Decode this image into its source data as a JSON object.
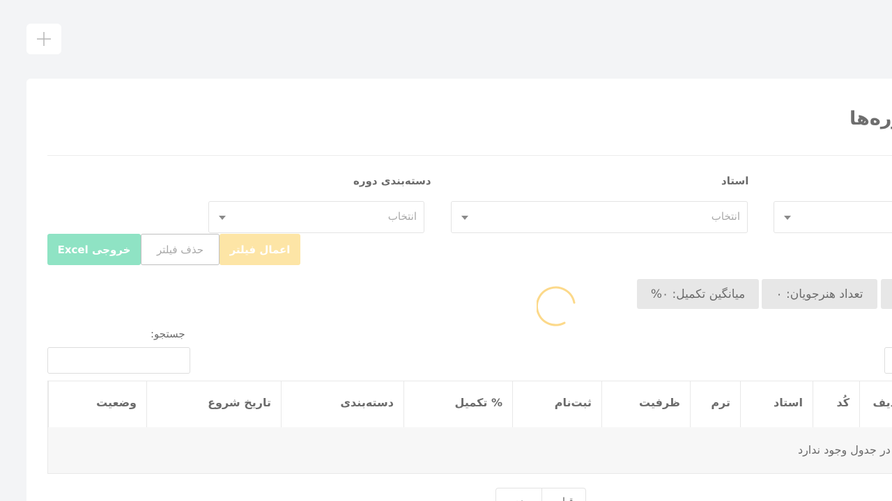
{
  "page": {
    "title": "دوره‌ها",
    "add_icon": "plus-icon"
  },
  "filters": {
    "category_label": "دسته‌بندی دوره",
    "teacher_label": "استاد",
    "category_placeholder": "انتخاب",
    "teacher_placeholder": "انتخاب"
  },
  "buttons": {
    "excel": "خروجی Excel",
    "clear": "حذف فیلتر",
    "apply": "اعمال فیلتر"
  },
  "stats": {
    "avg_completion": "میانگین تکمیل: ۰%",
    "students_count": "تعداد هنرجویان: ۰"
  },
  "search": {
    "label": "جستجو:",
    "value": ""
  },
  "table": {
    "columns": [
      "ردیف",
      "کُد",
      "استاد",
      "ترم",
      "ظرفیت",
      "ثبت‌نام",
      "% تکمیل",
      "دسته‌بندی",
      "تاریخ شروع",
      "وضعیت"
    ],
    "empty_message": "داده‌ای در جدول وجود ندارد"
  },
  "pagination": {
    "prev": "قبلی",
    "next": "بعدی"
  },
  "colors": {
    "accent_yellow": "#fde5a6",
    "accent_green": "#8fe3c4",
    "spinner": "#fcd98a"
  }
}
